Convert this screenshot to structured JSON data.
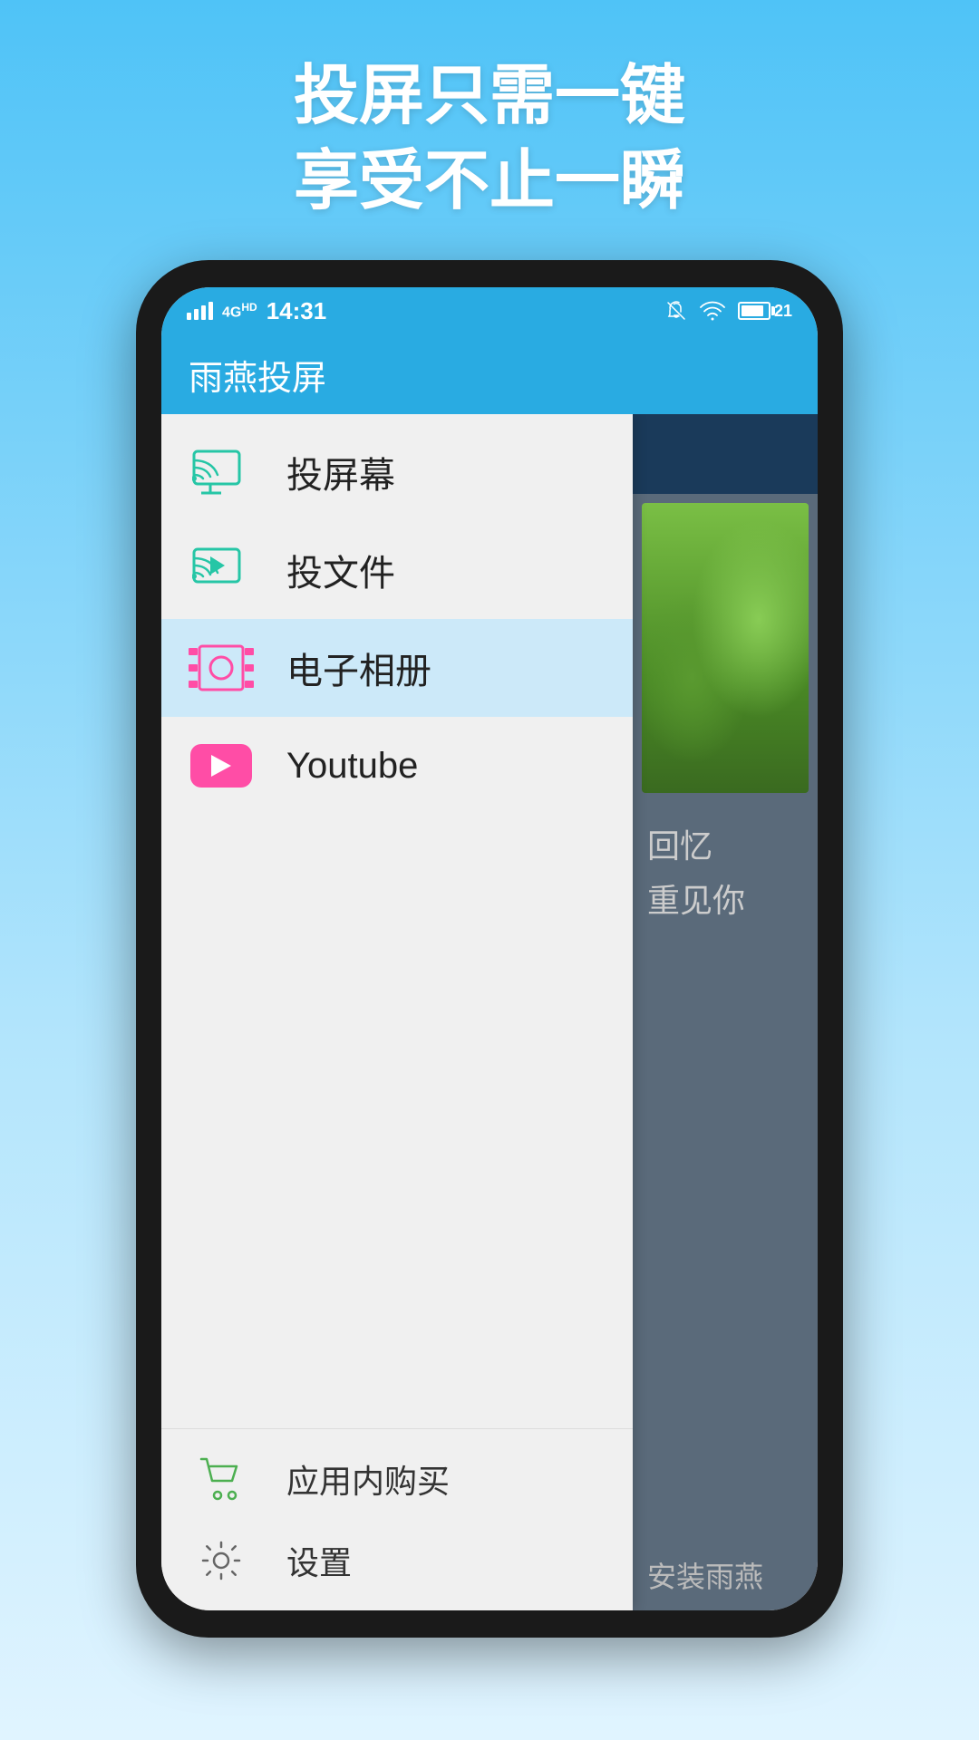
{
  "headline": {
    "line1": "投屏只需一键",
    "line2": "享受不止一瞬"
  },
  "statusBar": {
    "signal": "4G",
    "time": "14:31",
    "batteryLevel": 21
  },
  "appBar": {
    "title": "雨燕投屏"
  },
  "menu": {
    "items": [
      {
        "id": "cast-screen",
        "label": "投屏幕",
        "iconType": "cast-screen",
        "active": false
      },
      {
        "id": "cast-file",
        "label": "投文件",
        "iconType": "cast-file",
        "active": false
      },
      {
        "id": "album",
        "label": "电子相册",
        "iconType": "album",
        "active": true
      },
      {
        "id": "youtube",
        "label": "Youtube",
        "iconType": "youtube",
        "active": false
      }
    ],
    "bottomItems": [
      {
        "id": "purchase",
        "label": "应用内购买",
        "iconType": "cart"
      },
      {
        "id": "settings",
        "label": "设置",
        "iconType": "settings"
      }
    ]
  },
  "rightPanel": {
    "overlayText1": "忆",
    "overlayText2": "见你",
    "installText": "安装雨燕"
  }
}
